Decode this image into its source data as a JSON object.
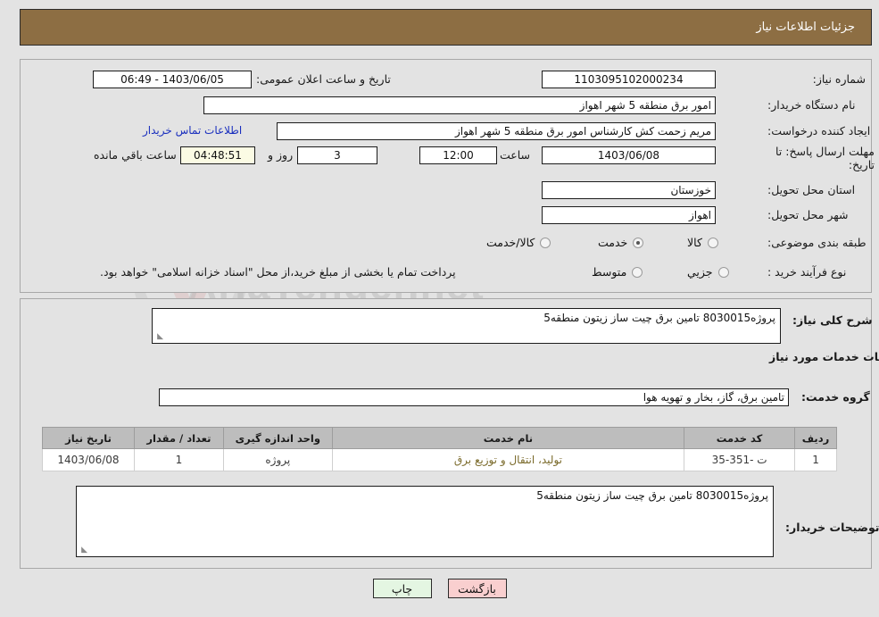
{
  "header": {
    "title": "جزئیات اطلاعات نیاز",
    "bg_color": "#8d6e43"
  },
  "watermark": {
    "text": "AriaTender.net",
    "shield": "shield-icon"
  },
  "top_panel": {
    "need_number": {
      "label": "شماره نیاز:",
      "value": "1103095102000234"
    },
    "announce_datetime": {
      "label": "تاریخ و ساعت اعلان عمومی:",
      "value": "1403/06/05 - 06:49"
    },
    "buyer_org": {
      "label": "نام دستگاه خریدار:",
      "value": "امور برق منطقه 5 شهر اهواز"
    },
    "creator": {
      "label": "ایجاد کننده درخواست:",
      "value": "مریم زحمت کش کارشناس امور برق منطقه 5 شهر اهواز"
    },
    "contact_link": "اطلاعات تماس خریدار",
    "deadline": {
      "label": "مهلت ارسال پاسخ: تا تاریخ:",
      "date": "1403/06/08",
      "time_label": "ساعت",
      "time": "12:00",
      "days": "3",
      "days_label": "روز و",
      "remaining": "04:48:51",
      "remaining_label": "ساعت باقي مانده"
    },
    "province": {
      "label": "استان محل تحویل:",
      "value": "خوزستان"
    },
    "city": {
      "label": "شهر محل تحویل:",
      "value": "اهواز"
    },
    "category": {
      "label": "طبقه بندی موضوعی:",
      "options": [
        "کالا",
        "خدمت",
        "کالا/خدمت"
      ],
      "selected": "خدمت"
    },
    "purchase_type": {
      "label": "نوع فرآیند خرید :",
      "options": [
        "جزیي",
        "متوسط"
      ],
      "selected": "",
      "note": "پرداخت تمام یا بخشی از مبلغ خرید،از محل \"اسناد خزانه اسلامی\" خواهد بود."
    }
  },
  "bottom_panel": {
    "need_description": {
      "label": "شرح کلی نیاز:",
      "value": "پروژه8030015 تامین برق چیت ساز زیتون منطقه5"
    },
    "services_heading": "اطلاعات خدمات مورد نیاز",
    "service_group": {
      "label": "گروه خدمت:",
      "value": "تامین برق، گاز، بخار و تهویه هوا"
    },
    "table": {
      "columns": [
        "ردیف",
        "کد خدمت",
        "نام خدمت",
        "واحد اندازه گیری",
        "تعداد / مقدار",
        "تاریخ نیاز"
      ],
      "rows": [
        {
          "row_no": "1",
          "service_code": "ت -351-35",
          "service_name": "تولید، انتقال و توزیع برق",
          "unit": "پروژه",
          "quantity": "1",
          "need_date": "1403/06/08"
        }
      ]
    },
    "buyer_notes": {
      "label": "توضیحات خریدار:",
      "value": "پروژه8030015 تامین برق چیت ساز زیتون منطقه5"
    }
  },
  "footer": {
    "print_label": "چاپ",
    "back_label": "بازگشت"
  }
}
